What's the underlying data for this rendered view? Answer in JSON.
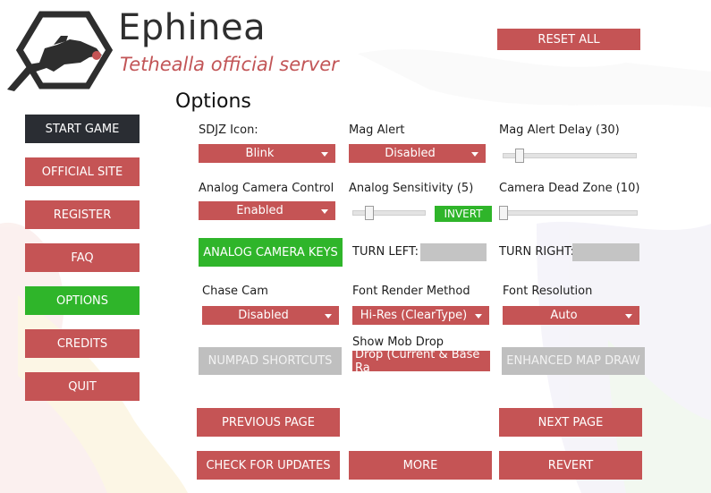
{
  "brand": {
    "title": "Ephinea",
    "subtitle": "Tethealla official server"
  },
  "page_title": "Options",
  "reset_all": "RESET ALL",
  "nav": [
    {
      "label": "START GAME"
    },
    {
      "label": "OFFICIAL SITE"
    },
    {
      "label": "REGISTER"
    },
    {
      "label": "FAQ"
    },
    {
      "label": "OPTIONS"
    },
    {
      "label": "CREDITS"
    },
    {
      "label": "QUIT"
    }
  ],
  "options": {
    "sdjz_icon": {
      "label": "SDJZ Icon:",
      "value": "Blink"
    },
    "mag_alert": {
      "label": "Mag Alert",
      "value": "Disabled"
    },
    "mag_alert_delay": {
      "label": "Mag Alert Delay (30)",
      "level": 0.1
    },
    "analog_camera_control": {
      "label": "Analog Camera Control",
      "value": "Enabled"
    },
    "analog_sensitivity": {
      "label": "Analog Sensitivity (5)",
      "level": 0.2
    },
    "invert": "INVERT",
    "camera_dead_zone": {
      "label": "Camera Dead Zone (10)",
      "level": 0.0
    },
    "analog_camera_keys": "ANALOG CAMERA KEYS",
    "turn_left": {
      "label": "TURN LEFT:",
      "value": ""
    },
    "turn_right": {
      "label": "TURN RIGHT:",
      "value": ""
    },
    "chase_cam": {
      "label": "Chase Cam",
      "value": "Disabled"
    },
    "font_render_method": {
      "label": "Font Render Method",
      "value": "Hi-Res (ClearType)"
    },
    "font_resolution": {
      "label": "Font Resolution",
      "value": "Auto"
    },
    "numpad_shortcuts": "NUMPAD SHORTCUTS",
    "show_mob_drop": {
      "label": "Show Mob Drop",
      "value": "Drop (Current & Base Ra"
    },
    "enhanced_map_draw": "ENHANCED MAP DRAW"
  },
  "footer": {
    "previous_page": "PREVIOUS PAGE",
    "next_page": "NEXT PAGE",
    "check_for_updates": "CHECK FOR UPDATES",
    "more": "MORE",
    "revert": "REVERT"
  },
  "colors": {
    "accent_red": "#c55455",
    "accent_green": "#2fb52a",
    "dark": "#2a2d33",
    "disabled_grey": "#bfbfbf"
  }
}
